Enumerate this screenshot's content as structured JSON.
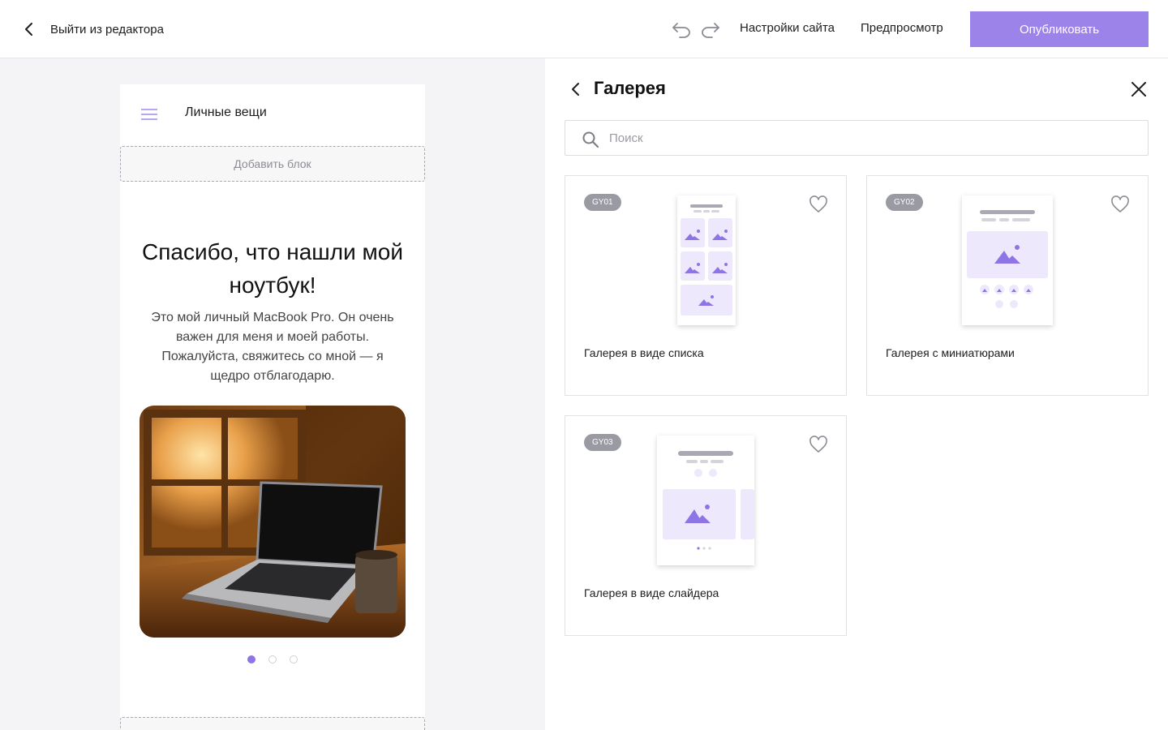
{
  "topbar": {
    "exit_label": "Выйти из редактора",
    "site_settings": "Настройки сайта",
    "preview": "Предпросмотр",
    "publish": "Опубликовать"
  },
  "colors": {
    "accent": "#9b83ea",
    "accent_dark": "#8f74e6",
    "thumb_fill": "#ede8fb",
    "canvas_bg": "#f4f4f6"
  },
  "preview": {
    "site_name": "Личные вещи",
    "add_block": "Добавить блок",
    "hero_title": "Спасибо, что нашли мой ноутбук!",
    "hero_text": "Это мой личный MacBook Pro. Он очень важен для меня и моей работы. Пожалуйста, свяжитесь со мной — я щедро отблагодарю.",
    "slider": {
      "slides": 3,
      "active": 1
    }
  },
  "panel": {
    "title": "Галерея",
    "search_placeholder": "Поиск",
    "cards": [
      {
        "code": "GY01",
        "label": "Галерея в виде списка",
        "icon": "gallery-list-thumbnail"
      },
      {
        "code": "GY02",
        "label": "Галерея с миниатюрами",
        "icon": "gallery-thumbnails-thumbnail"
      },
      {
        "code": "GY03",
        "label": "Галерея в виде слайдера",
        "icon": "gallery-slider-thumbnail"
      }
    ]
  }
}
